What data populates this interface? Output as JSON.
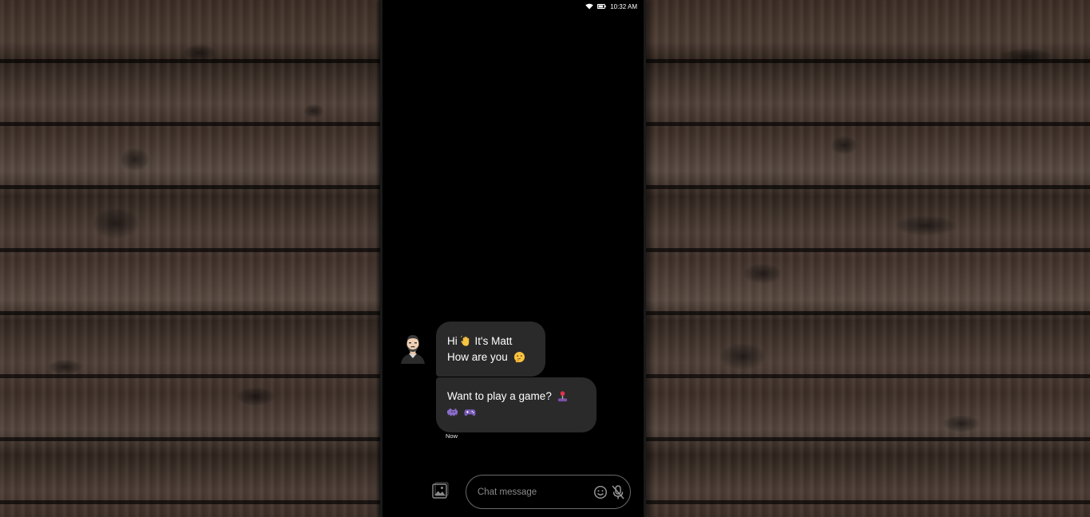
{
  "status_bar": {
    "time": "10:32 AM",
    "icons": [
      "wifi-icon",
      "battery-icon"
    ]
  },
  "conversation": {
    "contact_avatar": "avatar-icon",
    "messages": [
      {
        "lines": [
          {
            "parts": [
              "Hi",
              " It's Matt"
            ],
            "emojis": [
              "waving-hand-emoji"
            ]
          },
          {
            "parts": [
              "How are you"
            ],
            "emojis": [
              "thinking-face-emoji"
            ]
          }
        ]
      },
      {
        "lines": [
          {
            "parts": [
              "Want to play a game?"
            ],
            "emojis": [
              "joystick-emoji"
            ]
          },
          {
            "parts": [
              ""
            ],
            "emojis": [
              "space-invader-emoji",
              "game-controller-emoji"
            ]
          }
        ]
      }
    ],
    "timestamp": "Now"
  },
  "composer": {
    "placeholder": "Chat message",
    "value": "",
    "icons": [
      "gallery-icon",
      "emoji-icon",
      "mic-off-icon"
    ]
  },
  "colors": {
    "phone_background": "#000000",
    "bubble_background": "#2a2a2a",
    "text": "#ffffff",
    "input_border": "#6a6a6a"
  }
}
